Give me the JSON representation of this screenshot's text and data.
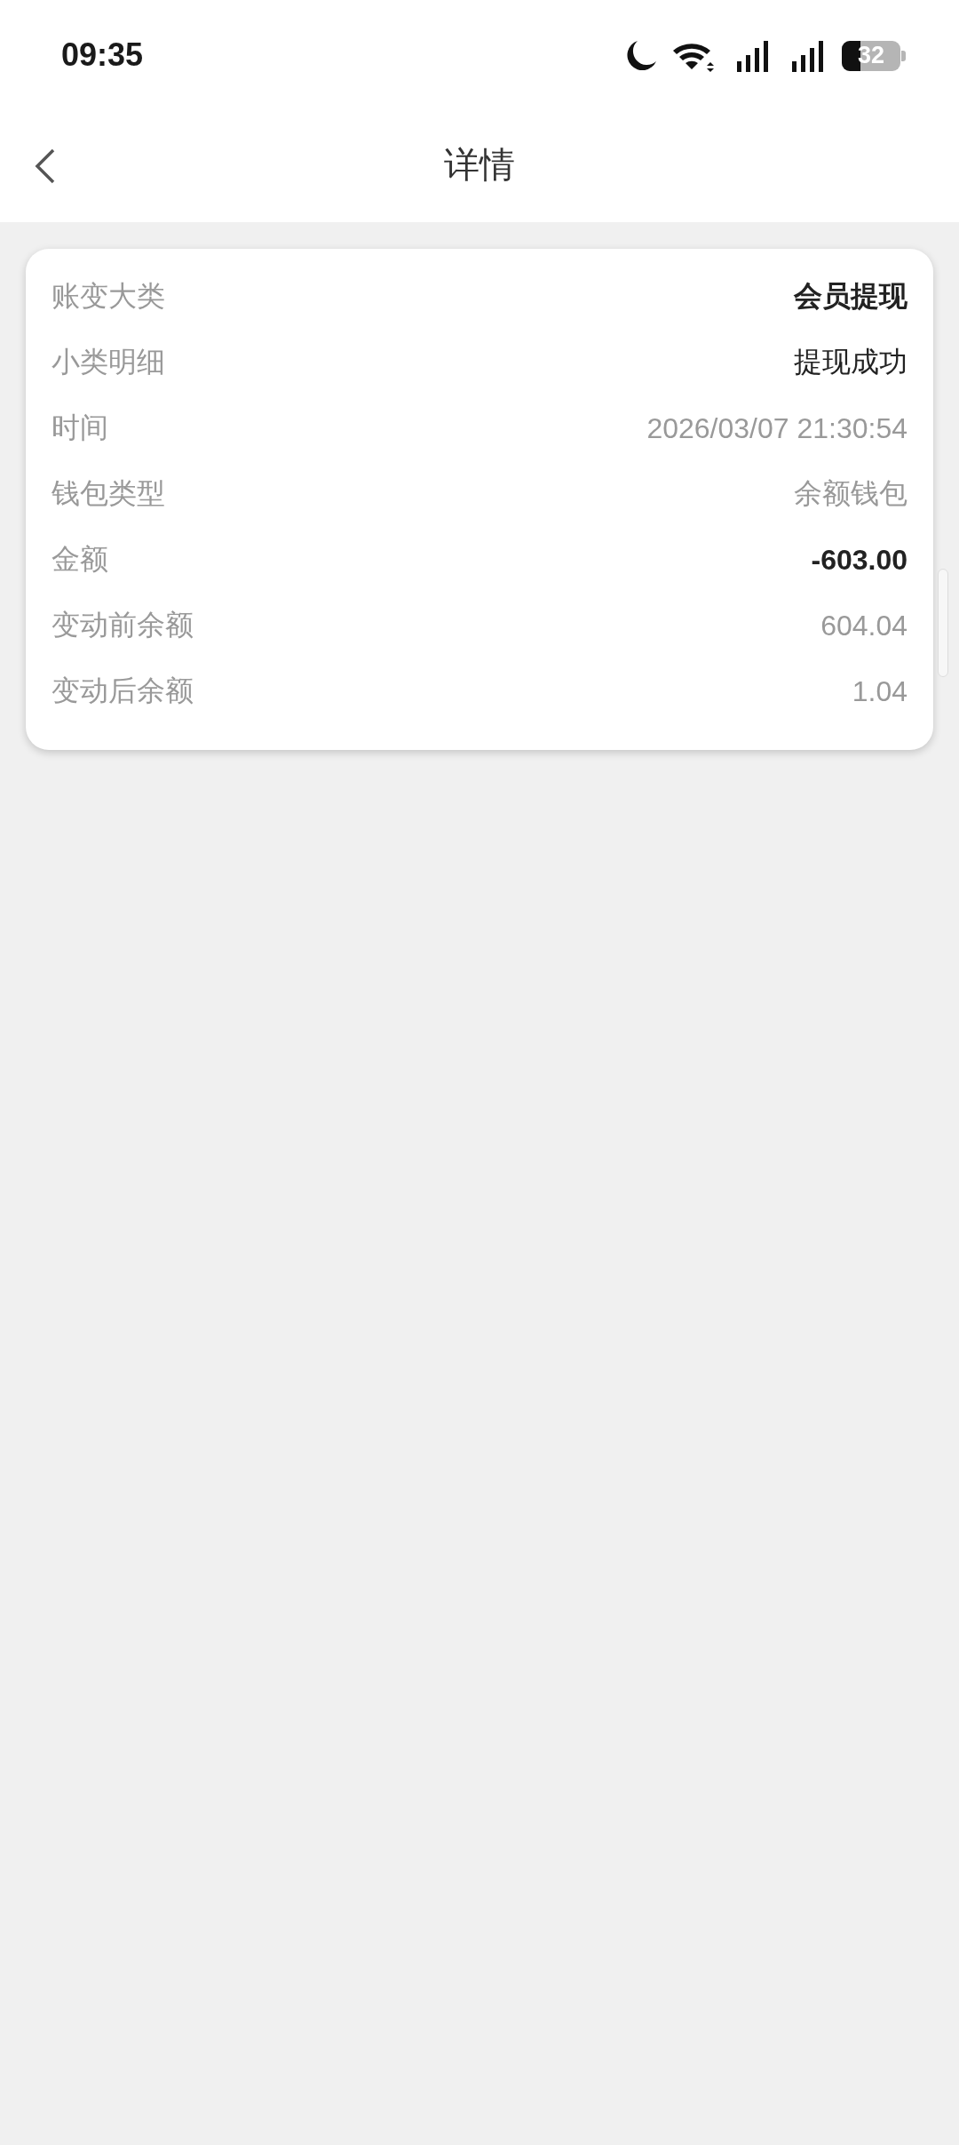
{
  "status_bar": {
    "time": "09:35",
    "battery": "32"
  },
  "header": {
    "title": "详情"
  },
  "details": [
    {
      "label": "账变大类",
      "value": "会员提现",
      "kind": "emphasis"
    },
    {
      "label": "小类明细",
      "value": "提现成功",
      "kind": "dark"
    },
    {
      "label": "时间",
      "value": "2026/03/07 21:30:54",
      "kind": "muted"
    },
    {
      "label": "钱包类型",
      "value": "余额钱包",
      "kind": "muted"
    },
    {
      "label": "金额",
      "value": "-603.00",
      "kind": "emphasis"
    },
    {
      "label": "变动前余额",
      "value": "604.04",
      "kind": "muted"
    },
    {
      "label": "变动后余额",
      "value": "1.04",
      "kind": "muted"
    }
  ]
}
